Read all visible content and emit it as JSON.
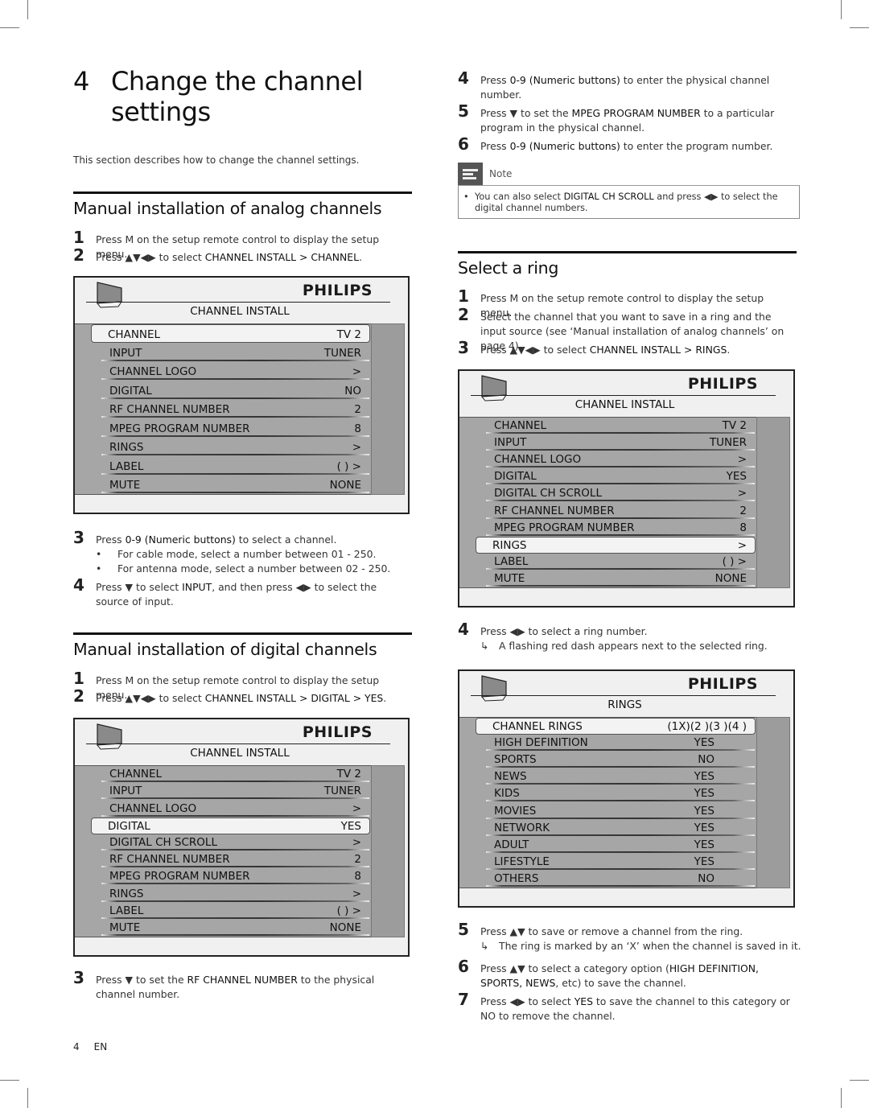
{
  "chapter": {
    "number": "4",
    "title": "Change the channel settings",
    "intro": "This section describes how to change the channel settings."
  },
  "symbols": {
    "all_arrows": "▲▼◀▶",
    "up_down": "▲▼",
    "down": "▼",
    "left_right": "◀▶",
    "result_arrow": "↳",
    "bullet": "•"
  },
  "analog": {
    "heading": "Manual installation of analog channels",
    "steps": [
      {
        "n": "1",
        "pre": "Press M on the setup remote control to display the setup menu.",
        "bold": "",
        "post": ""
      },
      {
        "n": "2",
        "pre": "Press ▲▼◀▶ to select ",
        "bold": "CHANNEL INSTALL > CHANNEL",
        "post": "."
      },
      {
        "n": "3",
        "pre": "Press ",
        "bold": "0-9 (Numeric buttons)",
        "post": " to select a channel."
      },
      {
        "n": "4",
        "pre": "Press ▼ to select ",
        "bold": "INPUT",
        "post": ", and then press ◀▶ to select the source of input."
      }
    ],
    "bullets": [
      "For cable mode, select a number between 01 - 250.",
      "For antenna mode, select a number between 02 - 250."
    ],
    "osd": {
      "brand": "PHILIPS",
      "title": "CHANNEL INSTALL",
      "selected_index": 0,
      "rows": [
        {
          "label": "CHANNEL",
          "value": "TV 2"
        },
        {
          "label": "INPUT",
          "value": "TUNER"
        },
        {
          "label": "CHANNEL LOGO",
          "value": ">"
        },
        {
          "label": "DIGITAL",
          "value": "NO"
        },
        {
          "label": "RF CHANNEL NUMBER",
          "value": "2"
        },
        {
          "label": "MPEG PROGRAM NUMBER",
          "value": "8"
        },
        {
          "label": "RINGS",
          "value": ">"
        },
        {
          "label": "LABEL",
          "value": "(        )  >"
        },
        {
          "label": "MUTE",
          "value": "NONE"
        }
      ]
    }
  },
  "digital": {
    "heading": "Manual installation of digital channels",
    "steps": [
      {
        "n": "1",
        "pre": "Press M on the setup remote control to display the setup menu.",
        "bold": "",
        "post": ""
      },
      {
        "n": "2",
        "pre": "Press ▲▼◀▶ to select ",
        "bold": "CHANNEL INSTALL > DIGITAL > YES",
        "post": "."
      },
      {
        "n": "3",
        "pre": "Press ▼ to set the ",
        "bold": "RF CHANNEL NUMBER",
        "post": " to the physical channel number."
      },
      {
        "n": "4",
        "pre": "Press ",
        "bold": "0-9 (Numeric buttons)",
        "post": " to enter the physical channel number."
      },
      {
        "n": "5",
        "pre": "Press ▼ to set the ",
        "bold": "MPEG PROGRAM NUMBER",
        "post": " to a particular program in the physical channel."
      },
      {
        "n": "6",
        "pre": "Press ",
        "bold": "0-9 (Numeric buttons)",
        "post": " to enter the program number."
      }
    ],
    "osd": {
      "brand": "PHILIPS",
      "title": "CHANNEL INSTALL",
      "selected_index": 3,
      "rows": [
        {
          "label": "CHANNEL",
          "value": "TV 2"
        },
        {
          "label": "INPUT",
          "value": "TUNER"
        },
        {
          "label": "CHANNEL LOGO",
          "value": ">"
        },
        {
          "label": "DIGITAL",
          "value": "YES"
        },
        {
          "label": "DIGITAL CH SCROLL",
          "value": ">"
        },
        {
          "label": "RF CHANNEL NUMBER",
          "value": "2"
        },
        {
          "label": "MPEG PROGRAM NUMBER",
          "value": "8"
        },
        {
          "label": "RINGS",
          "value": ">"
        },
        {
          "label": "LABEL",
          "value": "(        )  >"
        },
        {
          "label": "MUTE",
          "value": "NONE"
        }
      ]
    },
    "note": {
      "label": "Note",
      "pre": "You can also select ",
      "bold": "DIGITAL CH SCROLL",
      "post": " and press ◀▶ to select the digital channel numbers."
    }
  },
  "ring": {
    "heading": "Select a ring",
    "steps": [
      {
        "n": "1",
        "pre": "Press M on the setup remote control to display the setup menu.",
        "bold": "",
        "post": ""
      },
      {
        "n": "2",
        "pre": "Select the channel that you want to save in a ring and the input source (see ‘Manual installation of analog channels’ on page 4).",
        "bold": "",
        "post": ""
      },
      {
        "n": "3",
        "pre": "Press ▲▼◀▶ to select ",
        "bold": "CHANNEL INSTALL > RINGS",
        "post": "."
      },
      {
        "n": "4",
        "pre": "Press ◀▶ to select a ring number.",
        "bold": "",
        "post": ""
      },
      {
        "n": "5",
        "pre": "Press ▲▼ to save or remove a channel from the ring.",
        "bold": "",
        "post": ""
      },
      {
        "n": "6",
        "pre": "Press ▲▼ to select a category option (",
        "bold": "HIGH DEFINITION, SPORTS, NEWS",
        "post": ", etc) to save the channel."
      },
      {
        "n": "7",
        "pre": "Press ◀▶ to select ",
        "bold": "YES",
        "post": " to save the channel to this category or NO to remove the channel."
      }
    ],
    "results": [
      "A flashing red dash appears next to the selected ring.",
      "The ring is marked by an ‘X’ when the channel is saved in it."
    ],
    "osd_install": {
      "brand": "PHILIPS",
      "title": "CHANNEL INSTALL",
      "selected_index": 7,
      "rows": [
        {
          "label": "CHANNEL",
          "value": "TV 2"
        },
        {
          "label": "INPUT",
          "value": "TUNER"
        },
        {
          "label": "CHANNEL LOGO",
          "value": ">"
        },
        {
          "label": "DIGITAL",
          "value": "YES"
        },
        {
          "label": "DIGITAL CH SCROLL",
          "value": ">"
        },
        {
          "label": "RF CHANNEL NUMBER",
          "value": "2"
        },
        {
          "label": "MPEG PROGRAM NUMBER",
          "value": "8"
        },
        {
          "label": "RINGS",
          "value": ">"
        },
        {
          "label": "LABEL",
          "value": "(        )  >"
        },
        {
          "label": "MUTE",
          "value": "NONE"
        }
      ]
    },
    "osd_rings": {
      "brand": "PHILIPS",
      "title": "RINGS",
      "selected_index": 0,
      "rows": [
        {
          "label": "CHANNEL RINGS",
          "value": "(1X)(2 )(3 )(4 )"
        },
        {
          "label": "HIGH DEFINITION",
          "value": "YES"
        },
        {
          "label": "SPORTS",
          "value": "NO"
        },
        {
          "label": "NEWS",
          "value": "YES"
        },
        {
          "label": "KIDS",
          "value": "YES"
        },
        {
          "label": "MOVIES",
          "value": "YES"
        },
        {
          "label": "NETWORK",
          "value": "YES"
        },
        {
          "label": "ADULT",
          "value": "YES"
        },
        {
          "label": "LIFESTYLE",
          "value": "YES"
        },
        {
          "label": "OTHERS",
          "value": "NO"
        }
      ]
    }
  },
  "footer": {
    "page": "4",
    "lang": "EN"
  }
}
